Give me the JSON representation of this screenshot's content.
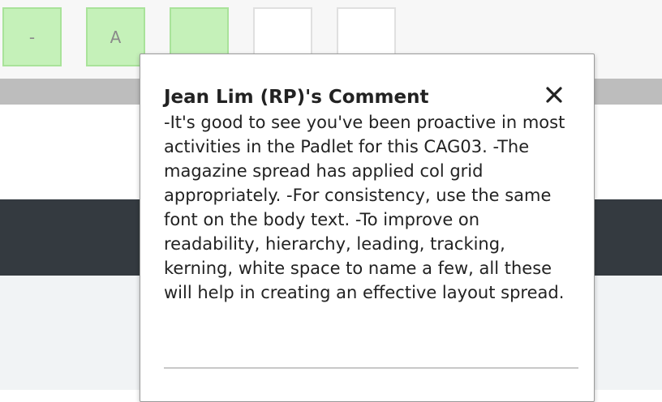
{
  "grade_row": {
    "cells": [
      {
        "label": "-",
        "filled": true
      },
      {
        "label": "A",
        "filled": true
      },
      {
        "label": "",
        "filled": true
      },
      {
        "label": "",
        "filled": false
      },
      {
        "label": "",
        "filled": false
      }
    ]
  },
  "comment_modal": {
    "title": "Jean Lim (RP)'s Comment",
    "body": "-It's good to see you've been proactive in most activities in the Padlet for this CAG03. -The magazine spread has applied col grid appropriately. -For consistency, use the same font on the body text. -To improve on readability, hierarchy, leading, tracking, kerning, white space to name a few, all these will help in creating an effective layout spread.",
    "close_icon": "close-icon"
  },
  "colors": {
    "filled_cell": "#c5f1b9",
    "dark_band": "#343a40",
    "grey_bar": "#bdbdbd"
  }
}
